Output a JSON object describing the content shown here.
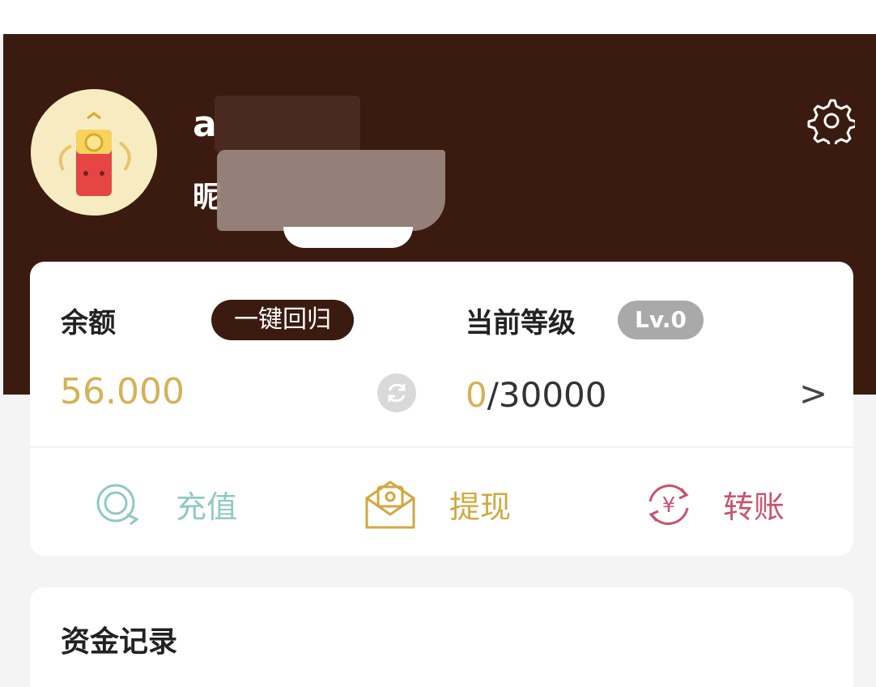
{
  "profile": {
    "account_id": "a",
    "nickname_prefix": "昵"
  },
  "icons": {
    "settings": "gear-icon",
    "refresh": "refresh-icon",
    "recharge": "recharge-icon",
    "withdraw": "envelope-icon",
    "transfer": "yen-exchange-icon"
  },
  "wallet": {
    "balance_label": "余额",
    "return_button": "一键回归",
    "balance_value": "56.000"
  },
  "level": {
    "label": "当前等级",
    "badge": "Lv.0",
    "current": "0",
    "target": "/30000",
    "more_arrow": ">"
  },
  "actions": {
    "recharge": "充值",
    "withdraw": "提现",
    "transfer": "转账"
  },
  "records": {
    "title": "资金记录"
  },
  "colors": {
    "header": "#3b1b10",
    "gold": "#d6b156",
    "recharge": "#8fcac2",
    "withdraw": "#d2a83f",
    "transfer": "#c9536c",
    "badge": "#a9a9a9"
  }
}
